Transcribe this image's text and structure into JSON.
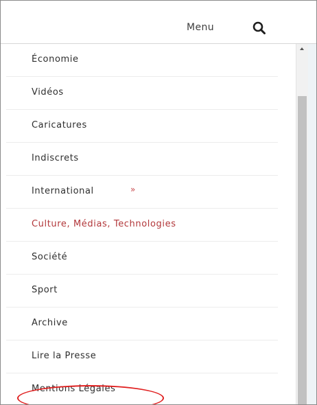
{
  "header": {
    "menu_label": "Menu",
    "search_icon": "search-icon"
  },
  "menu": {
    "items": [
      {
        "label": "Économie"
      },
      {
        "label": "Vidéos"
      },
      {
        "label": "Caricatures"
      },
      {
        "label": "Indiscrets"
      },
      {
        "label": "International",
        "expand_symbol": "»"
      },
      {
        "label": "Culture, Médias, Technologies",
        "active": true
      },
      {
        "label": "Société"
      },
      {
        "label": "Sport"
      },
      {
        "label": "Archive"
      },
      {
        "label": "Lire la Presse"
      },
      {
        "label": "Mentions Légales",
        "highlighted": true
      }
    ]
  },
  "colors": {
    "active_text": "#b2373a",
    "highlight_oval": "#e02020",
    "text": "#2e2e2e"
  }
}
